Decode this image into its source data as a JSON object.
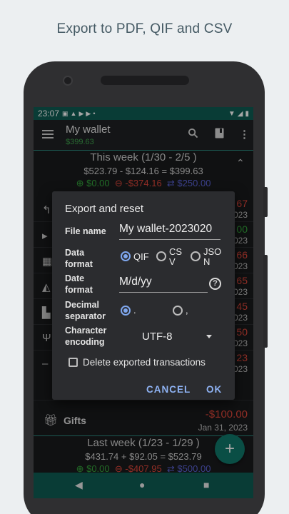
{
  "caption": "Export to PDF, QIF and CSV",
  "status": {
    "time": "23:07"
  },
  "appbar": {
    "title": "My wallet",
    "balance": "$399.63"
  },
  "this_week": {
    "title": "This week (1/30 - 2/5 )",
    "summary": "$523.79  - $124.16  = $399.63",
    "income": "⊕ $0.00",
    "expense": "⊖ -$374.16",
    "transfer": "⇄ $250.00"
  },
  "rows": [
    {
      "amount": "67",
      "date": "023",
      "color": "red"
    },
    {
      "amount": "00",
      "date": "023",
      "color": "green"
    },
    {
      "amount": "66",
      "date": "023",
      "color": "red"
    },
    {
      "amount": "65",
      "date": "023",
      "color": "red"
    },
    {
      "amount": "45",
      "date": "023",
      "color": "red"
    },
    {
      "amount": "50",
      "date": "023",
      "color": "red"
    },
    {
      "amount": "23",
      "date": "023",
      "color": "red"
    }
  ],
  "gifts_row": {
    "label": "Gifts",
    "amount": "-$100.00",
    "date": "Jan 31, 2023"
  },
  "last_week": {
    "title": "Last week (1/23 - 1/29 )",
    "summary": "$431.74  + $92.05  = $523.79",
    "income": "⊕ $0.00",
    "expense": "⊖ -$407.95",
    "transfer": "⇄ $500.00"
  },
  "dialog": {
    "title": "Export and reset",
    "file_name_label": "File name",
    "file_name_value": "My wallet-2023020",
    "data_format_label_1": "Data",
    "data_format_label_2": "format",
    "format_qif": "QIF",
    "format_csv_1": "CS",
    "format_csv_2": "V",
    "format_json_1": "JSO",
    "format_json_2": "N",
    "date_format_label_1": "Date",
    "date_format_label_2": "format",
    "date_format_value": "M/d/yy",
    "help_glyph": "?",
    "decimal_label_1": "Decimal",
    "decimal_label_2": "separator",
    "decimal_dot": ".",
    "decimal_comma": ",",
    "encoding_label_1": "Character",
    "encoding_label_2": "encoding",
    "encoding_value": "UTF-8",
    "delete_label": "Delete exported transactions",
    "cancel": "CANCEL",
    "ok": "OK"
  },
  "fab_label": "+",
  "colors": {
    "accent": "#0f5d54",
    "income": "#35a83c",
    "expense": "#e0483b",
    "transfer": "#5b63d6",
    "dialog_button": "#8fb3f4"
  }
}
